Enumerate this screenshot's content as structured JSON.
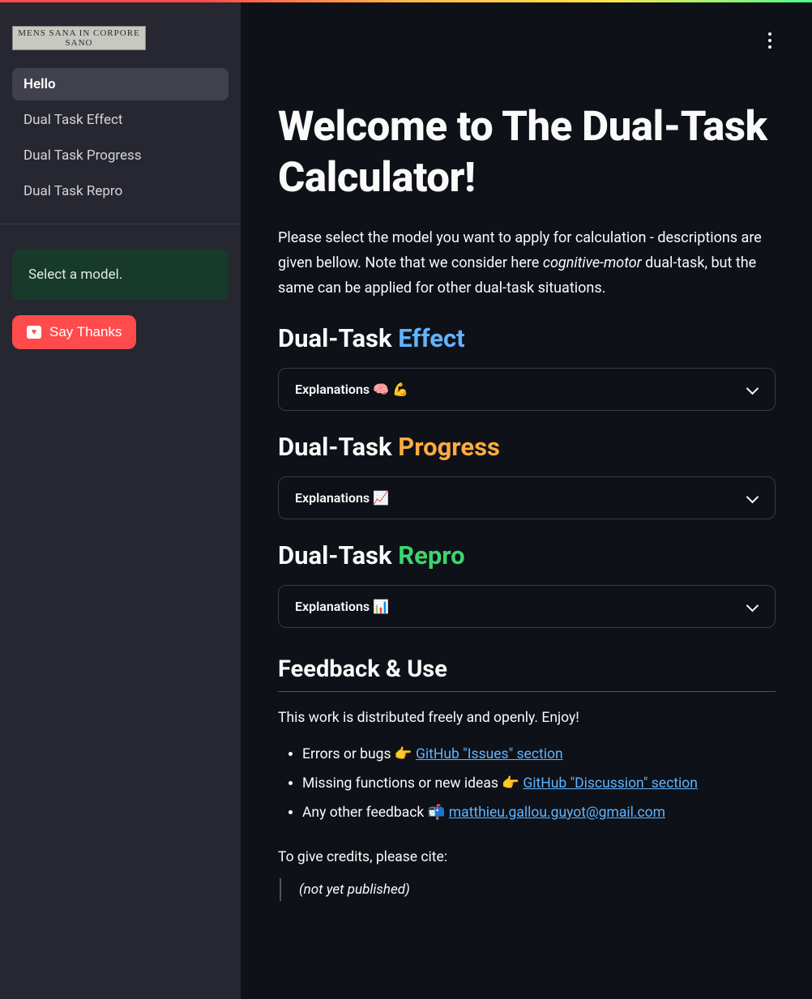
{
  "logo_text": "MENS SANA IN CORPORE SANO",
  "sidebar": {
    "items": [
      {
        "label": "Hello",
        "active": true
      },
      {
        "label": "Dual Task Effect",
        "active": false
      },
      {
        "label": "Dual Task Progress",
        "active": false
      },
      {
        "label": "Dual Task Repro",
        "active": false
      }
    ],
    "alert": "Select a model.",
    "thanks_label": "Say Thanks"
  },
  "main": {
    "title": "Welcome to The Dual-Task Calculator!",
    "intro_before": "Please select the model you want to apply for calculation - descriptions are given bellow. Note that we consider here ",
    "intro_em": "cognitive-motor",
    "intro_after": " dual-task, but the same can be applied for other dual-task situations.",
    "sections": [
      {
        "prefix": "Dual-Task ",
        "highlight": "Effect",
        "class": "c-blue",
        "expander": "Explanations 🧠 💪"
      },
      {
        "prefix": "Dual-Task ",
        "highlight": "Progress",
        "class": "c-orange",
        "expander": "Explanations 📈"
      },
      {
        "prefix": "Dual-Task ",
        "highlight": "Repro",
        "class": "c-green",
        "expander": "Explanations 📊"
      }
    ],
    "feedback": {
      "heading": "Feedback & Use",
      "lead": "This work is distributed freely and openly. Enjoy!",
      "items": [
        {
          "text": "Errors or bugs 👉 ",
          "link": "GitHub \"Issues\" section"
        },
        {
          "text": "Missing functions or new ideas 👉 ",
          "link": "GitHub \"Discussion\" section"
        },
        {
          "text": "Any other feedback 📬 ",
          "link": "matthieu.gallou.guyot@gmail.com"
        }
      ],
      "cite_intro": "To give credits, please cite:",
      "cite": "(not yet published)"
    }
  }
}
